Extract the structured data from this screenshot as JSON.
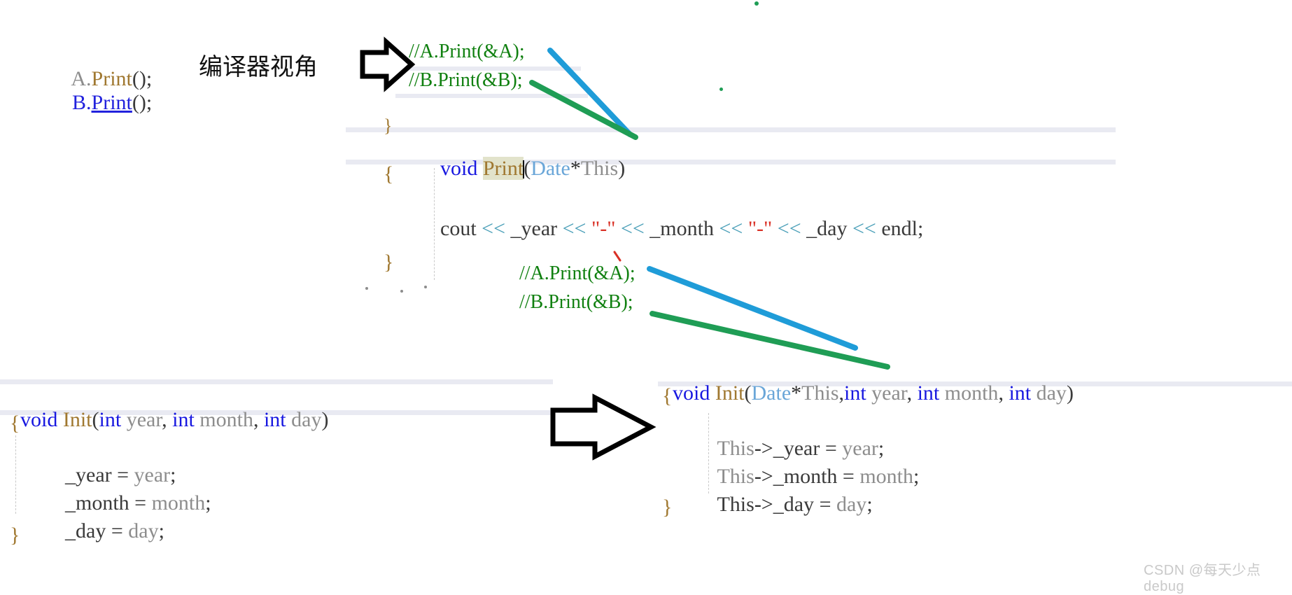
{
  "meta": {
    "title": "C++ member function compiler view diagram",
    "watermark": "CSDN @每天少点debug"
  },
  "colors": {
    "keyword": "#1818e0",
    "function": "#a07830",
    "identifier": "#8d8d8d",
    "type": "#6aa6d8",
    "comment": "#108010",
    "string": "#d93025",
    "shift_operator": "#4a9fb8",
    "highlight_bg": "#e2e3cb",
    "current_line_band": "#e9eaf2",
    "arrow_blue": "#1f9cd8",
    "arrow_green": "#1f9d55",
    "watermark": "#c9c9c9"
  },
  "annotation": {
    "label": "编译器视角"
  },
  "call_site": {
    "lines": [
      {
        "prefix": "A.",
        "name": "Print",
        "suffix": "();",
        "name_style": "function"
      },
      {
        "prefix": "B.",
        "name": "Print",
        "suffix": "();",
        "name_style": "keyword-underlined"
      }
    ]
  },
  "compiler_view_top": {
    "lines": [
      "//A.Print(&A);",
      "//B.Print(&B);"
    ]
  },
  "print_block": {
    "stray_brace": "}",
    "signature": {
      "keyword": "void",
      "name": "Print",
      "open_paren": "(",
      "param_type": "Date",
      "star": "*",
      "param_name": "This",
      "close_paren": ")"
    },
    "open_brace": "{",
    "body": {
      "cout": "cout",
      "shift": "<<",
      "year": "_year",
      "dash": "\"-\"",
      "month": "_month",
      "day": "_day",
      "endl": "endl",
      "semicolon": ";"
    },
    "close_brace": "}"
  },
  "compiler_view_bottom": {
    "lines": [
      "//A.Print(&A);",
      "//B.Print(&B);"
    ]
  },
  "init_original": {
    "signature": {
      "keyword": "void",
      "name": "Init",
      "open_paren": "(",
      "params": [
        {
          "type": "int",
          "name": "year"
        },
        {
          "type": "int",
          "name": "month"
        },
        {
          "type": "int",
          "name": "day"
        }
      ],
      "close_paren": ")"
    },
    "open_brace": "{",
    "statements": [
      {
        "lhs": "_year",
        "eq": "=",
        "rhs": "year",
        "semi": ";"
      },
      {
        "lhs": "_month",
        "eq": "=",
        "rhs": "month",
        "semi": ";"
      },
      {
        "lhs": "_day",
        "eq": "=",
        "rhs": "day",
        "semi": ";"
      }
    ],
    "close_brace": "}"
  },
  "init_transformed": {
    "signature": {
      "keyword": "void",
      "name": "Init",
      "open_paren": "(",
      "this_type": "Date",
      "star": "*",
      "this_name": "This",
      "comma": ",",
      "params": [
        {
          "type": "int",
          "name": "year"
        },
        {
          "type": "int",
          "name": "month"
        },
        {
          "type": "int",
          "name": "day"
        }
      ],
      "close_paren": ")"
    },
    "open_brace": "{",
    "statements": [
      {
        "this": "This",
        "arrow": "->",
        "lhs": "_year",
        "eq": "=",
        "rhs": "year",
        "semi": ";"
      },
      {
        "this": "This",
        "arrow": "->",
        "lhs": "_month",
        "eq": "=",
        "rhs": "month",
        "semi": ";"
      },
      {
        "this": "This",
        "arrow": "->",
        "lhs": "_day",
        "eq": "=",
        "rhs": "day",
        "semi": ";"
      }
    ],
    "close_brace": "}"
  },
  "arrows": {
    "top_block_arrow": "arrow-right-outline",
    "bottom_block_arrow": "arrow-right-outline",
    "connector_blue_top": "line-blue",
    "connector_green_top": "line-green",
    "connector_blue_bottom": "line-blue",
    "connector_green_bottom": "line-green"
  }
}
